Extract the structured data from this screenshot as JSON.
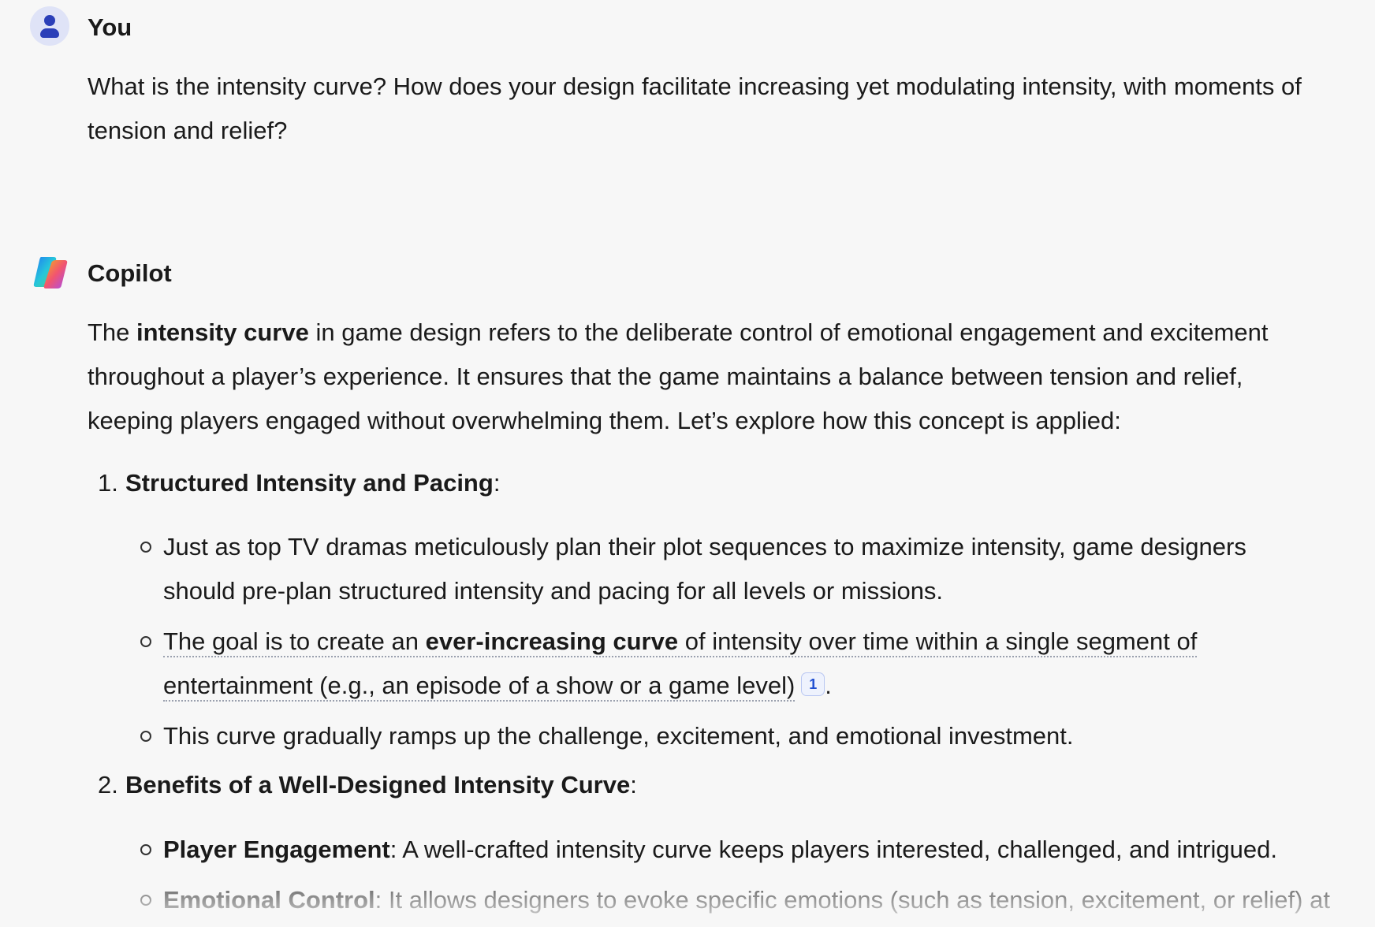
{
  "user_message": {
    "author": "You",
    "avatar_icon": "user-avatar-icon",
    "text": "What is the intensity curve? How does your design facilitate increasing yet modulating intensity, with moments of tension and relief?"
  },
  "copilot_message": {
    "author": "Copilot",
    "avatar_icon": "copilot-logo-icon",
    "intro": {
      "pre": "The ",
      "bold": "intensity curve",
      "post_line1": " in game design refers to the deliberate control of emotional engagement and excitement",
      "line2": "throughout a player’s experience. It ensures that the game maintains a balance between tension and relief,",
      "line3": "keeping players engaged without overwhelming them. Let’s explore how this concept is applied:"
    },
    "sections": [
      {
        "number": "1.",
        "title": "Structured Intensity and Pacing",
        "suffix": ":",
        "bullets": [
          {
            "line1": "Just as top TV dramas meticulously plan their plot sequences to maximize intensity, game designers",
            "line2": "should pre-plan structured intensity and pacing for all levels or missions."
          },
          {
            "pre": "The goal is to create an ",
            "bold": "ever-increasing curve",
            "post": " of intensity over time within a single segment of",
            "line2": "entertainment (e.g., an episode of a show or a game level)",
            "citation": "1",
            "end": "."
          },
          {
            "line1": "This curve gradually ramps up the challenge, excitement, and emotional investment."
          }
        ]
      },
      {
        "number": "2.",
        "title": "Benefits of a Well-Designed Intensity Curve",
        "suffix": ":",
        "bullets": [
          {
            "bold": "Player Engagement",
            "text": ": A well-crafted intensity curve keeps players interested, challenged, and intrigued."
          },
          {
            "bold": "Emotional Control",
            "text": ": It allows designers to evoke specific emotions (such as tension, excitement, or relief) at"
          }
        ]
      }
    ]
  }
}
